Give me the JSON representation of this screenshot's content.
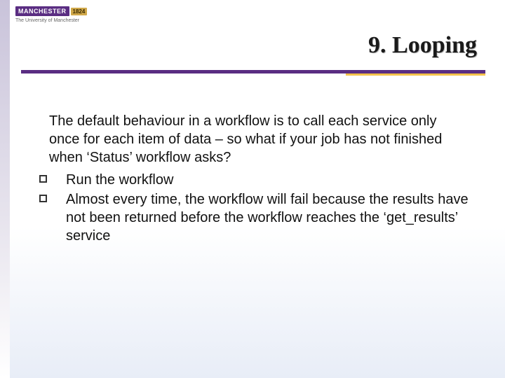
{
  "logo": {
    "name": "MANCHESTER",
    "year": "1824",
    "subtitle": "The University of Manchester"
  },
  "title": "9. Looping",
  "intro": "The default behaviour in a workflow is to call each service only once for each item of data –  so what if your job has not finished when ‘Status’ workflow asks?",
  "bullets": [
    "Run the workflow",
    "Almost every time, the workflow will fail because the results have not been returned before the workflow reaches the ‘get_results’ service"
  ]
}
